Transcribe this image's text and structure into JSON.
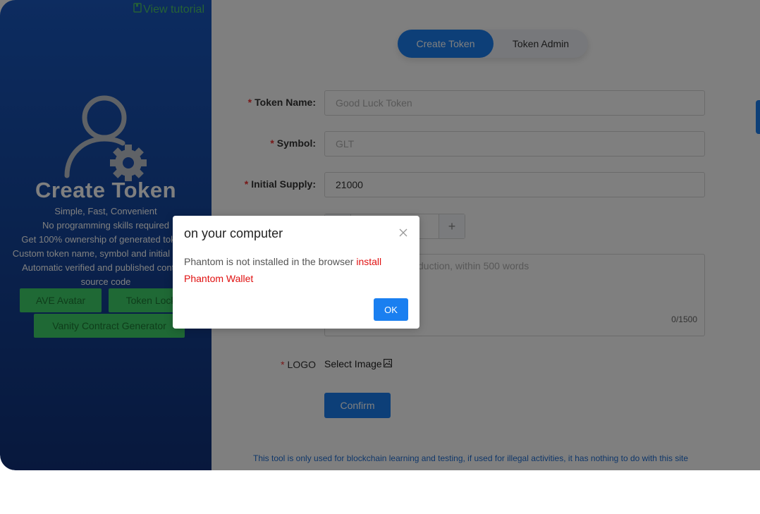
{
  "sidebar": {
    "tutorial_link": "View tutorial",
    "title": "Create Token",
    "features": [
      "Simple, Fast, Convenient",
      "No programming skills required",
      "Get 100% ownership of generated tokens",
      "Custom token name, symbol and initial supply",
      "Automatic verified and published contract",
      "source code"
    ],
    "buttons": {
      "ave_avatar": "AVE Avatar",
      "token_lock": "Token Lock",
      "vanity_generator": "Vanity Contract Generator"
    }
  },
  "tabs": {
    "create_token": "Create Token",
    "token_admin": "Token Admin"
  },
  "form": {
    "token_name": {
      "label": "Token Name:",
      "placeholder": "Good Luck Token",
      "value": ""
    },
    "symbol": {
      "label": "Symbol:",
      "placeholder": "GLT",
      "value": ""
    },
    "initial_supply": {
      "label": "Initial Supply:",
      "value": "21000"
    },
    "decimals": {
      "plus": "+"
    },
    "description": {
      "placeholder_visible": "duction, within 500 words",
      "counter": "0/1500"
    },
    "logo": {
      "label": "LOGO",
      "select_label": "Select Image"
    },
    "confirm_label": "Confirm"
  },
  "disclaimer": "This tool is only used for blockchain learning and testing, if used for illegal activities, it has nothing to do with this site",
  "dialog": {
    "title": "on your computer",
    "message": "Phantom is not installed in the browser ",
    "link": "install Phantom Wallet",
    "ok_label": "OK"
  },
  "colors": {
    "sidebar_top": "#1a58c0",
    "sidebar_bottom": "#10317a",
    "accent": "#1a7ff0",
    "green": "#3ed26a",
    "required": "#f03030",
    "dialog_link": "#e01010"
  }
}
